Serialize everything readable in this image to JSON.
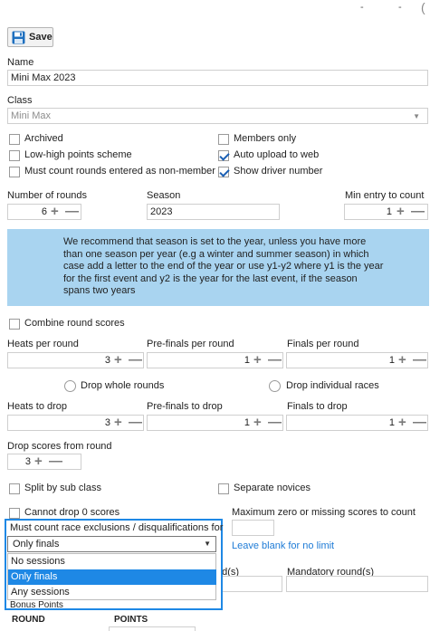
{
  "toolbar": {
    "save_label": "Save"
  },
  "name": {
    "label": "Name",
    "value": "Mini Max 2023"
  },
  "class": {
    "label": "Class",
    "value": "Mini Max"
  },
  "checkboxes": {
    "archived": {
      "label": "Archived",
      "checked": false
    },
    "members_only": {
      "label": "Members only",
      "checked": false
    },
    "low_high": {
      "label": "Low-high points scheme",
      "checked": false
    },
    "auto_upload": {
      "label": "Auto upload to web",
      "checked": true
    },
    "must_count_rounds": {
      "label": "Must count rounds entered as non-member",
      "checked": false
    },
    "show_driver_number": {
      "label": "Show driver number",
      "checked": true
    },
    "combine_round_scores": {
      "label": "Combine round scores",
      "checked": false
    },
    "split_by_sub_class": {
      "label": "Split by sub class",
      "checked": false
    },
    "separate_novices": {
      "label": "Separate novices",
      "checked": false
    },
    "cannot_drop_zero": {
      "label": "Cannot drop 0 scores",
      "checked": false
    }
  },
  "rounds": {
    "number_label": "Number of rounds",
    "number_value": "6",
    "season_label": "Season",
    "season_value": "2023",
    "min_entry_label": "Min entry to count",
    "min_entry_value": "1"
  },
  "banner_text": "We recommend that season is set to the year, unless you have more than one season per year (e.g a winter and summer season) in which case add a letter to the end of the year or use y1-y2 where y1 is the year for the first event and y2 is the year for the last event, if the season spans two years",
  "per_round": {
    "heats_label": "Heats per round",
    "heats_value": "3",
    "prefinals_label": "Pre-finals per round",
    "prefinals_value": "1",
    "finals_label": "Finals per round",
    "finals_value": "1"
  },
  "drop_mode": {
    "whole_rounds": "Drop whole rounds",
    "individual_races": "Drop individual races"
  },
  "to_drop": {
    "heats_label": "Heats to drop",
    "heats_value": "3",
    "prefinals_label": "Pre-finals to drop",
    "prefinals_value": "1",
    "finals_label": "Finals to drop",
    "finals_value": "1"
  },
  "drop_from_round": {
    "label": "Drop scores from round",
    "value": "3"
  },
  "max_zero": {
    "label": "Maximum zero or missing scores to count",
    "hint": "Leave blank for no limit"
  },
  "exclusions": {
    "label": "Must count race exclusions / disqualifications for",
    "selected": "Only finals",
    "options": [
      "No sessions",
      "Only finals",
      "Any sessions"
    ]
  },
  "partial_labels": {
    "round_suffix": "nd(s)",
    "mandatory": "Mandatory round(s)",
    "bonus": "Bonus Points"
  },
  "table_headers": [
    "ROUND",
    "POINTS"
  ],
  "window_controls": [
    "-",
    "-",
    "("
  ]
}
